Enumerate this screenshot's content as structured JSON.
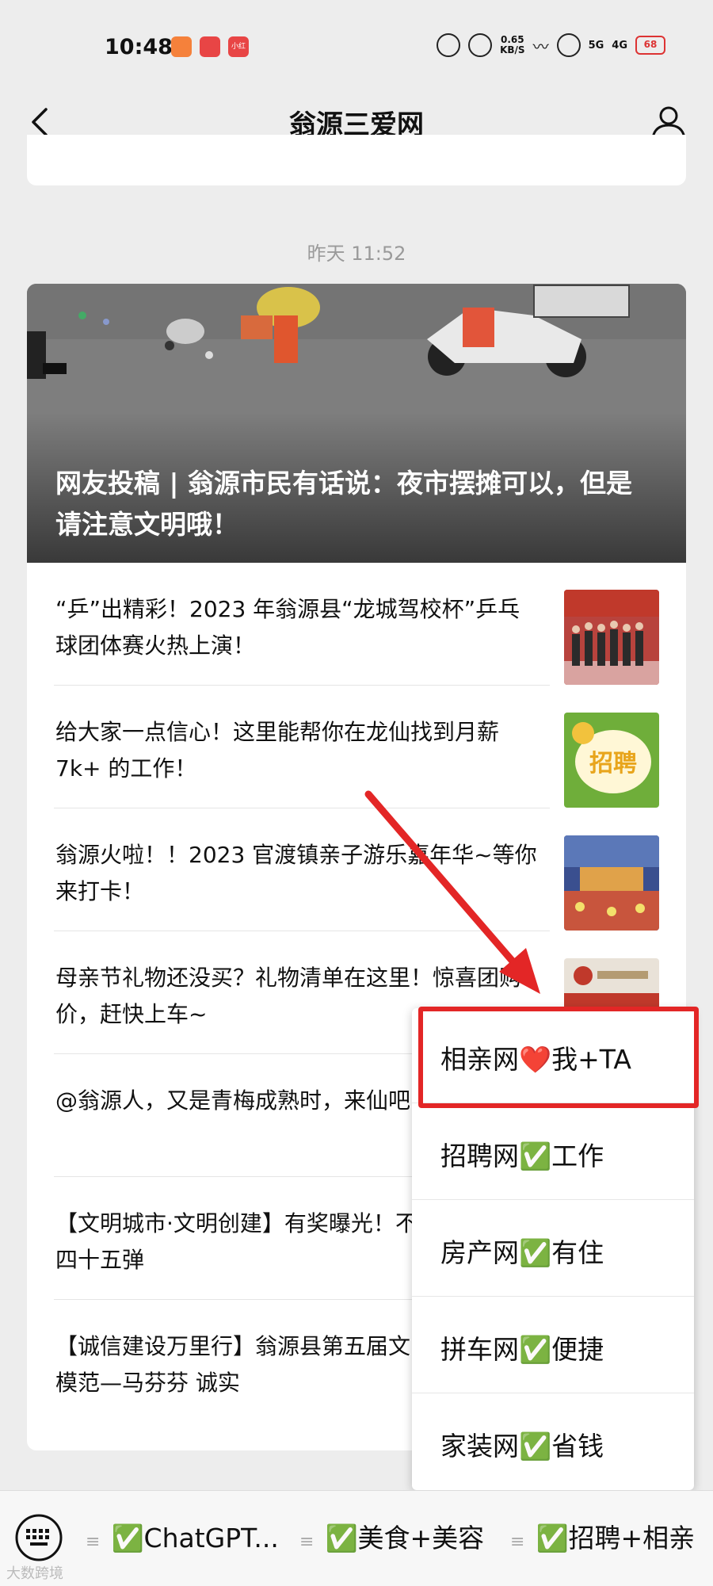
{
  "status_bar": {
    "time": "10:48",
    "app_icons": [
      "icon-1",
      "icon-2",
      "小红书"
    ],
    "net_speed_value": "0.65",
    "net_speed_unit": "KB/S",
    "signal_5g": "5G",
    "signal_4g": "4G",
    "battery": "68"
  },
  "nav": {
    "title": "翁源三爱网"
  },
  "timestamp": "昨天 11:52",
  "hero": {
    "title": "网友投稿 | 翁源市民有话说：夜市摆摊可以，但是请注意文明哦！"
  },
  "news": [
    {
      "text": "“乒”出精彩！2023 年翁源县“龙城驾校杯”乒乓球团体赛火热上演！"
    },
    {
      "text": "给大家一点信心！这里能帮你在龙仙找到月薪 7k+ 的工作！"
    },
    {
      "text": "翁源火啦！！2023 官渡镇亲子游乐嘉年华~等你来打卡！"
    },
    {
      "text": "母亲节礼物还没买？礼物清单在这里！惊喜团购价，赶快上车~"
    },
    {
      "text": "@翁源人，又是青梅成熟时，来仙吧！"
    },
    {
      "text": "【文明城市·文明创建】有奖曝光！不文明现象第四十五弹"
    },
    {
      "text": "【诚信建设万里行】翁源县第五届文明翁源”道德模范—马芬芬 诚实"
    }
  ],
  "thumb_label": "招聘",
  "popup": {
    "items": [
      {
        "label": "相亲网❤️我+TA"
      },
      {
        "label": "招聘网✅工作"
      },
      {
        "label": "房产网✅有住"
      },
      {
        "label": "拼车网✅便捷"
      },
      {
        "label": "家装网✅省钱"
      }
    ]
  },
  "bottom_bar": {
    "tabs": [
      {
        "label": "✅ChatGPT..."
      },
      {
        "label": "✅美食+美容"
      },
      {
        "label": "✅招聘+相亲"
      }
    ],
    "watermark": "大数跨境"
  },
  "colors": {
    "highlight": "#e32626",
    "arrow": "#e32626",
    "background": "#ededed"
  }
}
